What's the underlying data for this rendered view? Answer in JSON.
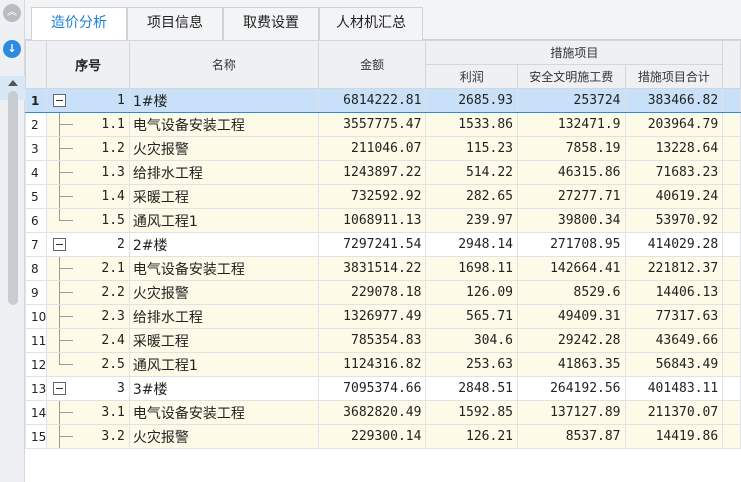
{
  "tabs": [
    "造价分析",
    "项目信息",
    "取费设置",
    "人材机汇总"
  ],
  "left_icons": {
    "collapse": "double-chevron-up-icon",
    "download": "download-icon"
  },
  "headers": {
    "seq": "序号",
    "name": "名称",
    "amount": "金额",
    "group": "措施项目",
    "profit": "利润",
    "safety": "安全文明施工费",
    "measure_total": "措施项目合计"
  },
  "rows": [
    {
      "row": "1",
      "seq": "1",
      "level": 0,
      "name": "1#楼",
      "amount": "6814222.81",
      "profit": "2685.93",
      "safety": "253724",
      "total": "383466.82"
    },
    {
      "row": "2",
      "seq": "1.1",
      "level": 1,
      "name": "电气设备安装工程",
      "amount": "3557775.47",
      "profit": "1533.86",
      "safety": "132471.9",
      "total": "203964.79"
    },
    {
      "row": "3",
      "seq": "1.2",
      "level": 1,
      "name": "火灾报警",
      "amount": "211046.07",
      "profit": "115.23",
      "safety": "7858.19",
      "total": "13228.64"
    },
    {
      "row": "4",
      "seq": "1.3",
      "level": 1,
      "name": "给排水工程",
      "amount": "1243897.22",
      "profit": "514.22",
      "safety": "46315.86",
      "total": "71683.23"
    },
    {
      "row": "5",
      "seq": "1.4",
      "level": 1,
      "name": "采暖工程",
      "amount": "732592.92",
      "profit": "282.65",
      "safety": "27277.71",
      "total": "40619.24"
    },
    {
      "row": "6",
      "seq": "1.5",
      "level": 1,
      "name": "通风工程1",
      "amount": "1068911.13",
      "profit": "239.97",
      "safety": "39800.34",
      "total": "53970.92",
      "last": true
    },
    {
      "row": "7",
      "seq": "2",
      "level": 0,
      "name": "2#楼",
      "amount": "7297241.54",
      "profit": "2948.14",
      "safety": "271708.95",
      "total": "414029.28"
    },
    {
      "row": "8",
      "seq": "2.1",
      "level": 1,
      "name": "电气设备安装工程",
      "amount": "3831514.22",
      "profit": "1698.11",
      "safety": "142664.41",
      "total": "221812.37"
    },
    {
      "row": "9",
      "seq": "2.2",
      "level": 1,
      "name": "火灾报警",
      "amount": "229078.18",
      "profit": "126.09",
      "safety": "8529.6",
      "total": "14406.13"
    },
    {
      "row": "10",
      "seq": "2.3",
      "level": 1,
      "name": "给排水工程",
      "amount": "1326977.49",
      "profit": "565.71",
      "safety": "49409.31",
      "total": "77317.63"
    },
    {
      "row": "11",
      "seq": "2.4",
      "level": 1,
      "name": "采暖工程",
      "amount": "785354.83",
      "profit": "304.6",
      "safety": "29242.28",
      "total": "43649.66"
    },
    {
      "row": "12",
      "seq": "2.5",
      "level": 1,
      "name": "通风工程1",
      "amount": "1124316.82",
      "profit": "253.63",
      "safety": "41863.35",
      "total": "56843.49",
      "last": true
    },
    {
      "row": "13",
      "seq": "3",
      "level": 0,
      "name": "3#楼",
      "amount": "7095374.66",
      "profit": "2848.51",
      "safety": "264192.56",
      "total": "401483.11"
    },
    {
      "row": "14",
      "seq": "3.1",
      "level": 1,
      "name": "电气设备安装工程",
      "amount": "3682820.49",
      "profit": "1592.85",
      "safety": "137127.89",
      "total": "211370.07"
    },
    {
      "row": "15",
      "seq": "3.2",
      "level": 1,
      "name": "火灾报警",
      "amount": "229300.14",
      "profit": "126.21",
      "safety": "8537.87",
      "total": "14419.86"
    }
  ],
  "selected_row": "1"
}
